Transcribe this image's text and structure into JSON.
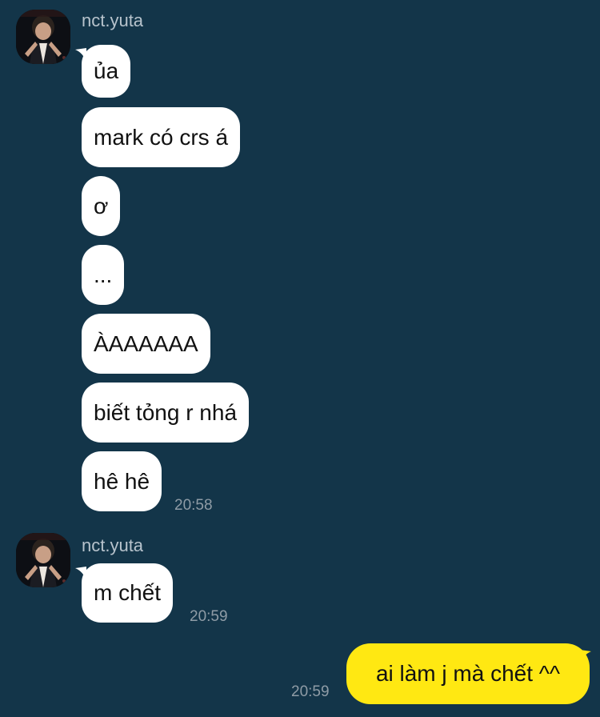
{
  "conversation": {
    "groups": [
      {
        "sender": "nct.yuta",
        "avatar": "profile-photo-icon",
        "messages": [
          "ủa",
          "mark có crs á",
          "ơ",
          "...",
          "ÀAAAAAA",
          "biết tỏng r nhá",
          "hê hê"
        ],
        "time": "20:58"
      },
      {
        "sender": "nct.yuta",
        "avatar": "profile-photo-icon",
        "messages": [
          "m chết"
        ],
        "time": "20:59"
      }
    ],
    "outgoing": {
      "message": "ai làm j mà chết ^^",
      "time": "20:59"
    }
  },
  "colors": {
    "background": "#133549",
    "incoming_bubble": "#ffffff",
    "outgoing_bubble": "#ffe812",
    "timestamp": "#8f9ca6",
    "sender_name": "#b7c3cc"
  }
}
